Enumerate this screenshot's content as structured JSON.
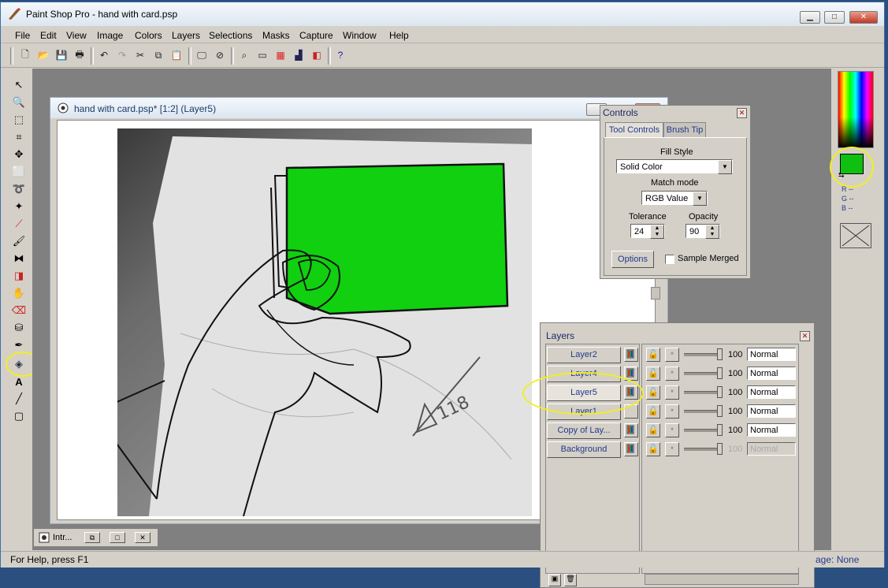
{
  "window": {
    "title": "Paint Shop Pro - hand with card.psp",
    "minimize": "▁",
    "maximize": "□",
    "close": "✕"
  },
  "menu": [
    "File",
    "Edit",
    "View",
    "Image",
    "Colors",
    "Layers",
    "Selections",
    "Masks",
    "Capture",
    "Window",
    "Help"
  ],
  "image_window": {
    "title": "hand with card.psp* [1:2] (Layer5)",
    "card_color": "#10d010"
  },
  "controls": {
    "title": "Controls",
    "tabs": [
      "Tool Controls",
      "Brush Tip"
    ],
    "fill_style_label": "Fill Style",
    "fill_style_value": "Solid Color",
    "match_mode_label": "Match mode",
    "match_mode_value": "RGB Value",
    "tolerance_label": "Tolerance",
    "tolerance_value": "24",
    "opacity_label": "Opacity",
    "opacity_value": "90",
    "options_label": "Options",
    "sample_merged_label": "Sample Merged"
  },
  "layers": {
    "title": "Layers",
    "rows": [
      {
        "name": "Layer2",
        "opacity": "100",
        "blend": "Normal",
        "selected": false,
        "disabled": false
      },
      {
        "name": "Layer4",
        "opacity": "100",
        "blend": "Normal",
        "selected": false,
        "disabled": false
      },
      {
        "name": "Layer5",
        "opacity": "100",
        "blend": "Normal",
        "selected": true,
        "disabled": false
      },
      {
        "name": "Layer1",
        "opacity": "100",
        "blend": "Normal",
        "selected": false,
        "disabled": false
      },
      {
        "name": "Copy of Lay...",
        "opacity": "100",
        "blend": "Normal",
        "selected": false,
        "disabled": false
      },
      {
        "name": "Background",
        "opacity": "100",
        "blend": "Normal",
        "selected": false,
        "disabled": true
      }
    ]
  },
  "color_palette": {
    "foreground": "#10c010",
    "background": "#ffffff",
    "r_label": "R --",
    "g_label": "G --",
    "b_label": "B --"
  },
  "minimized_window": {
    "title": "Intr..."
  },
  "status": {
    "help": "For Help, press F1",
    "right": "age: None"
  },
  "highlight_color": "#f2ee22"
}
